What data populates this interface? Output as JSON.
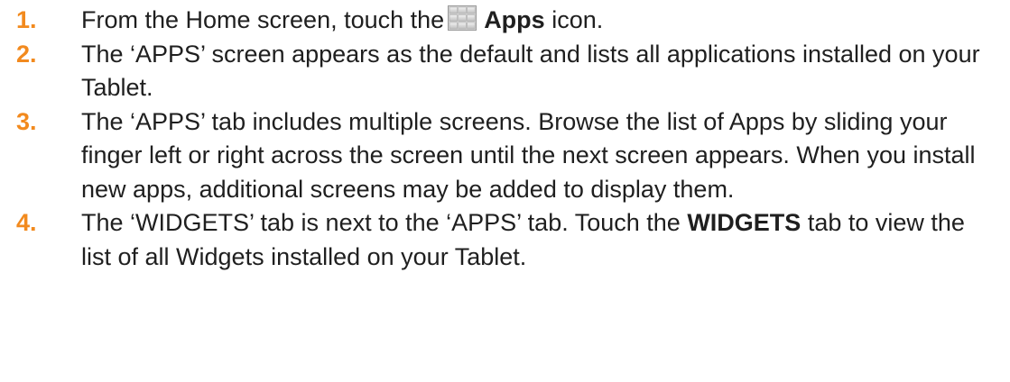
{
  "steps": [
    {
      "number": "1.",
      "before_icon": "From the Home screen, touch the",
      "icon": "apps-grid-icon",
      "bold": "Apps",
      "after": " icon."
    },
    {
      "number": "2.",
      "text": "The ‘APPS’ screen appears as the default and lists all applications installed on your Tablet."
    },
    {
      "number": "3.",
      "text": "The ‘APPS’ tab includes multiple screens. Browse the list of Apps by sliding your finger left or right across the screen until the next screen appears. When you install new apps, additional screens may be added to display them."
    },
    {
      "number": "4.",
      "before_bold": "The ‘WIDGETS’ tab is next to the ‘APPS’ tab. Touch the ",
      "bold": "WIDGETS",
      "after": " tab to view the list of all Widgets installed on your Tablet."
    }
  ],
  "colors": {
    "number": "#f28a1e",
    "text": "#1f1f1f"
  }
}
